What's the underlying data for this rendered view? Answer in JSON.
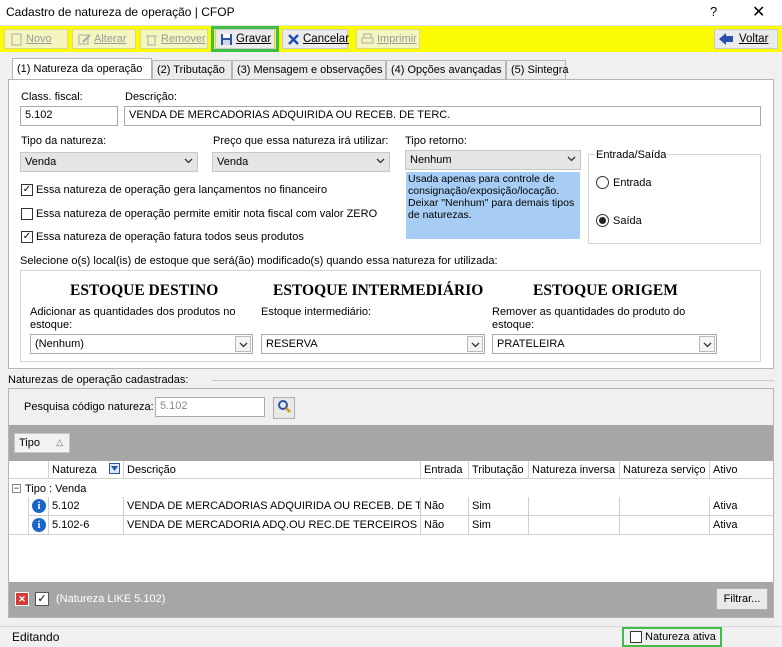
{
  "window": {
    "title": "Cadastro de natureza de operação | CFOP",
    "help": "?",
    "close": "✕"
  },
  "toolbar": {
    "novo": "Novo",
    "alterar": "Alterar",
    "remover": "Remover",
    "gravar": "Gravar",
    "cancelar": "Cancelar",
    "imprimir": "Imprimir",
    "voltar": "Voltar"
  },
  "tabs": [
    "(1) Natureza da operação",
    "(2) Tributação",
    "(3) Mensagem e observações",
    "(4) Opções avançadas",
    "(5) Sintegra"
  ],
  "form": {
    "class_fiscal_label": "Class. fiscal:",
    "class_fiscal_value": "5.102",
    "descricao_label": "Descrição:",
    "descricao_value": "VENDA DE MERCADORIAS ADQUIRIDA OU RECEB. DE TERC.",
    "tipo_natureza_label": "Tipo da natureza:",
    "tipo_natureza_value": "Venda",
    "preco_label": "Preço que essa natureza irá utilizar:",
    "preco_value": "Venda",
    "tipo_retorno_label": "Tipo retorno:",
    "tipo_retorno_value": "Nenhum",
    "tipo_retorno_info": "Usada apenas para controle de consignação/exposição/locação. Deixar \"Nenhum\" para demais tipos de naturezas.",
    "checkboxes": [
      {
        "label": "Essa natureza de operação gera lançamentos no financeiro",
        "checked": true
      },
      {
        "label": "Essa natureza de operação permite emitir nota fiscal com valor ZERO",
        "checked": false
      },
      {
        "label": "Essa natureza de operação fatura todos seus produtos",
        "checked": true
      }
    ],
    "entrada_saida": {
      "title": "Entrada/Saída",
      "entrada": "Entrada",
      "saida": "Saída",
      "selected": "Saída"
    },
    "estoque_prompt": "Selecione o(s) local(is) de estoque que será(ão) modificado(s) quando essa natureza for utilizada:",
    "estoque": {
      "destino_title": "ESTOQUE DESTINO",
      "destino_label": "Adicionar as quantidades dos produtos no estoque:",
      "destino_value": "(Nenhum)",
      "inter_title": "ESTOQUE INTERMEDIÁRIO",
      "inter_label": "Estoque intermediário:",
      "inter_value": "RESERVA",
      "origem_title": "ESTOQUE ORIGEM",
      "origem_label": "Remover as quantidades do produto do estoque:",
      "origem_value": "PRATELEIRA"
    }
  },
  "list": {
    "section_label": "Naturezas de operação cadastradas:",
    "search_label": "Pesquisa código natureza:",
    "search_value": "5.102",
    "group_header": "Tipo",
    "columns": [
      "Natureza",
      "Descrição",
      "Entrada",
      "Tributação",
      "Natureza inversa",
      "Natureza serviço",
      "Ativo"
    ],
    "group_row": "Tipo : Venda",
    "rows": [
      {
        "natureza": "5.102",
        "descricao": "VENDA DE MERCADORIAS ADQUIRIDA OU RECEB. DE TERC.",
        "entrada": "Não",
        "tributacao": "Sim",
        "inversa": "",
        "servico": "",
        "ativo": "Ativa"
      },
      {
        "natureza": "5.102-6",
        "descricao": "VENDA DE MERCADORIA ADQ.OU REC.DE TERCEIROS",
        "entrada": "Não",
        "tributacao": "Sim",
        "inversa": "",
        "servico": "",
        "ativo": "Ativa"
      }
    ],
    "filter_text": "(Natureza LIKE 5.102)",
    "filter_button": "Filtrar..."
  },
  "status": {
    "mode": "Editando",
    "ativa_label": "Natureza ativa"
  },
  "colors": {
    "toolbar": "#fbfc04",
    "highlight": "#3fbf4a",
    "info": "#a8cdf5"
  }
}
